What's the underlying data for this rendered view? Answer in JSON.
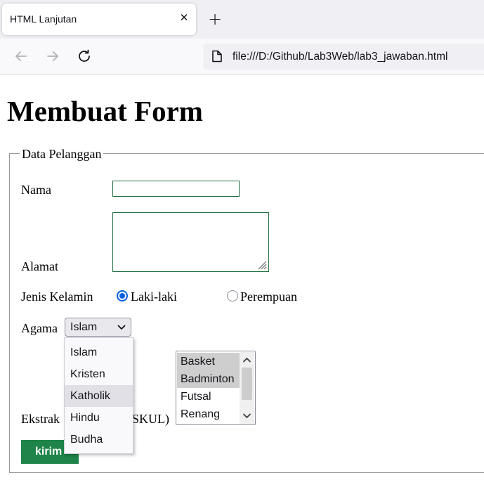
{
  "browser": {
    "tab_title": "HTML Lanjutan",
    "close_glyph": "✕",
    "new_tab_glyph": "+",
    "url": "file:///D:/Github/Lab3Web/lab3_jawaban.html"
  },
  "page": {
    "title": "Membuat Form",
    "fieldset_legend": "Data Pelanggan"
  },
  "form": {
    "nama_label": "Nama",
    "nama_value": "",
    "alamat_label": "Alamat",
    "alamat_value": "",
    "gender_label": "Jenis Kelamin",
    "gender_options": [
      {
        "label": "Laki-laki",
        "checked": true
      },
      {
        "label": "Perempuan",
        "checked": false
      }
    ],
    "agama_label": "Agama",
    "agama_selected": "Islam",
    "agama_options": [
      "Islam",
      "Kristen",
      "Katholik",
      "Hindu",
      "Budha"
    ],
    "agama_hovered": "Katholik",
    "ekskul_label_left": "Ekstrak",
    "ekskul_label_right": "SKUL)",
    "ekskul_options": [
      {
        "label": "Basket",
        "selected": true
      },
      {
        "label": "Badminton",
        "selected": true
      },
      {
        "label": "Futsal",
        "selected": false
      },
      {
        "label": "Renang",
        "selected": false
      }
    ],
    "submit_label": "kirim"
  },
  "colors": {
    "accent_blue": "#0060df",
    "submit_green": "#1e8449",
    "input_border": "#1f6f3f"
  }
}
